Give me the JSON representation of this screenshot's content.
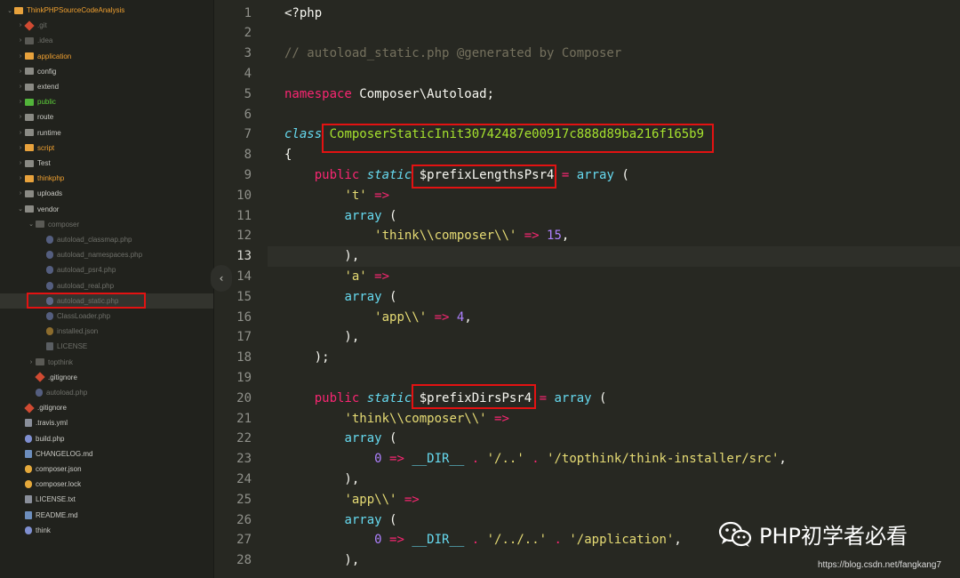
{
  "sidebar": {
    "items": [
      {
        "label": "ThinkPHPSourceCodeAnalysis",
        "kind": "root",
        "color": "orange"
      },
      {
        "label": ".git",
        "kind": "git",
        "color": "dim"
      },
      {
        "label": ".idea",
        "kind": "folder",
        "color": "dim"
      },
      {
        "label": "application",
        "kind": "folder",
        "color": "orange"
      },
      {
        "label": "config",
        "kind": "folder",
        "color": "normal"
      },
      {
        "label": "extend",
        "kind": "folder",
        "color": "normal"
      },
      {
        "label": "public",
        "kind": "folder",
        "color": "green"
      },
      {
        "label": "route",
        "kind": "folder",
        "color": "normal"
      },
      {
        "label": "runtime",
        "kind": "folder",
        "color": "normal"
      },
      {
        "label": "script",
        "kind": "folder",
        "color": "orange"
      },
      {
        "label": "Test",
        "kind": "folder",
        "color": "normal"
      },
      {
        "label": "thinkphp",
        "kind": "folder",
        "color": "orange"
      },
      {
        "label": "uploads",
        "kind": "folder",
        "color": "normal"
      },
      {
        "label": "vendor",
        "kind": "folder-open",
        "color": "normal"
      },
      {
        "label": "composer",
        "kind": "folder-open",
        "color": "dim"
      },
      {
        "label": "autoload_classmap.php",
        "kind": "php",
        "color": "dim"
      },
      {
        "label": "autoload_namespaces.php",
        "kind": "php",
        "color": "dim"
      },
      {
        "label": "autoload_psr4.php",
        "kind": "php",
        "color": "dim"
      },
      {
        "label": "autoload_real.php",
        "kind": "php",
        "color": "dim"
      },
      {
        "label": "autoload_static.php",
        "kind": "php",
        "color": "dim"
      },
      {
        "label": "ClassLoader.php",
        "kind": "php",
        "color": "dim"
      },
      {
        "label": "installed.json",
        "kind": "json",
        "color": "dim"
      },
      {
        "label": "LICENSE",
        "kind": "txt",
        "color": "dim"
      },
      {
        "label": "topthink",
        "kind": "folder",
        "color": "dim"
      },
      {
        "label": ".gitignore",
        "kind": "git",
        "color": "normal"
      },
      {
        "label": "autoload.php",
        "kind": "php",
        "color": "dim"
      },
      {
        "label": ".gitignore",
        "kind": "git",
        "color": "normal"
      },
      {
        "label": ".travis.yml",
        "kind": "txt",
        "color": "normal"
      },
      {
        "label": "build.php",
        "kind": "php",
        "color": "normal"
      },
      {
        "label": "CHANGELOG.md",
        "kind": "md",
        "color": "normal"
      },
      {
        "label": "composer.json",
        "kind": "json",
        "color": "normal"
      },
      {
        "label": "composer.lock",
        "kind": "lock",
        "color": "normal"
      },
      {
        "label": "LICENSE.txt",
        "kind": "txt",
        "color": "normal"
      },
      {
        "label": "README.md",
        "kind": "md",
        "color": "normal"
      },
      {
        "label": "think",
        "kind": "php",
        "color": "normal"
      }
    ],
    "selected_item": "autoload_static.php",
    "collapse_glyph": "‹"
  },
  "editor": {
    "filename": "autoload_static.php",
    "active_line": 13,
    "line_numbers": [
      "1",
      "2",
      "3",
      "4",
      "5",
      "6",
      "7",
      "8",
      "9",
      "10",
      "11",
      "12",
      "13",
      "14",
      "15",
      "16",
      "17",
      "18",
      "19",
      "20",
      "21",
      "22",
      "23",
      "24",
      "25",
      "26",
      "27",
      "28"
    ],
    "lines": [
      {
        "tokens": [
          {
            "t": "<?php",
            "c": "var"
          }
        ]
      },
      {
        "tokens": []
      },
      {
        "tokens": [
          {
            "t": "// autoload_static.php @generated by Composer",
            "c": "cm"
          }
        ]
      },
      {
        "tokens": []
      },
      {
        "tokens": [
          {
            "t": "namespace",
            "c": "kw"
          },
          {
            "t": " Composer\\Autoload;",
            "c": "var"
          }
        ]
      },
      {
        "tokens": []
      },
      {
        "tokens": [
          {
            "t": "class",
            "c": "st"
          },
          {
            "t": " ",
            "c": "var"
          },
          {
            "t": "ComposerStaticInit30742487e00917c888d89ba216f165b9",
            "c": "cls"
          }
        ]
      },
      {
        "tokens": [
          {
            "t": "{",
            "c": "var"
          }
        ]
      },
      {
        "tokens": [
          {
            "t": "    public ",
            "c": "kw"
          },
          {
            "t": "static",
            "c": "st"
          },
          {
            "t": " ",
            "c": "var"
          },
          {
            "t": "$prefixLengthsPsr4",
            "c": "var"
          },
          {
            "t": " = ",
            "c": "kw"
          },
          {
            "t": "array",
            "c": "fn"
          },
          {
            "t": " (",
            "c": "var"
          }
        ]
      },
      {
        "tokens": [
          {
            "t": "        ",
            "c": "var"
          },
          {
            "t": "'t'",
            "c": "str"
          },
          {
            "t": " =>",
            "c": "kw"
          }
        ]
      },
      {
        "tokens": [
          {
            "t": "        ",
            "c": "var"
          },
          {
            "t": "array",
            "c": "fn"
          },
          {
            "t": " (",
            "c": "var"
          }
        ]
      },
      {
        "tokens": [
          {
            "t": "            ",
            "c": "var"
          },
          {
            "t": "'think\\\\composer\\\\'",
            "c": "str"
          },
          {
            "t": " => ",
            "c": "kw"
          },
          {
            "t": "15",
            "c": "num"
          },
          {
            "t": ",",
            "c": "var"
          }
        ]
      },
      {
        "tokens": [
          {
            "t": "        ),",
            "c": "var"
          }
        ]
      },
      {
        "tokens": [
          {
            "t": "        ",
            "c": "var"
          },
          {
            "t": "'a'",
            "c": "str"
          },
          {
            "t": " =>",
            "c": "kw"
          }
        ]
      },
      {
        "tokens": [
          {
            "t": "        ",
            "c": "var"
          },
          {
            "t": "array",
            "c": "fn"
          },
          {
            "t": " (",
            "c": "var"
          }
        ]
      },
      {
        "tokens": [
          {
            "t": "            ",
            "c": "var"
          },
          {
            "t": "'app\\\\'",
            "c": "str"
          },
          {
            "t": " => ",
            "c": "kw"
          },
          {
            "t": "4",
            "c": "num"
          },
          {
            "t": ",",
            "c": "var"
          }
        ]
      },
      {
        "tokens": [
          {
            "t": "        ),",
            "c": "var"
          }
        ]
      },
      {
        "tokens": [
          {
            "t": "    );",
            "c": "var"
          }
        ]
      },
      {
        "tokens": []
      },
      {
        "tokens": [
          {
            "t": "    public ",
            "c": "kw"
          },
          {
            "t": "static",
            "c": "st"
          },
          {
            "t": " ",
            "c": "var"
          },
          {
            "t": "$prefixDirsPsr4",
            "c": "var"
          },
          {
            "t": " = ",
            "c": "kw"
          },
          {
            "t": "array",
            "c": "fn"
          },
          {
            "t": " (",
            "c": "var"
          }
        ]
      },
      {
        "tokens": [
          {
            "t": "        ",
            "c": "var"
          },
          {
            "t": "'think\\\\composer\\\\'",
            "c": "str"
          },
          {
            "t": " =>",
            "c": "kw"
          }
        ]
      },
      {
        "tokens": [
          {
            "t": "        ",
            "c": "var"
          },
          {
            "t": "array",
            "c": "fn"
          },
          {
            "t": " (",
            "c": "var"
          }
        ]
      },
      {
        "tokens": [
          {
            "t": "            ",
            "c": "var"
          },
          {
            "t": "0",
            "c": "num"
          },
          {
            "t": " => ",
            "c": "kw"
          },
          {
            "t": "__DIR__",
            "c": "fn"
          },
          {
            "t": " . ",
            "c": "kw"
          },
          {
            "t": "'/..'",
            "c": "str"
          },
          {
            "t": " . ",
            "c": "kw"
          },
          {
            "t": "'/topthink/think-installer/src'",
            "c": "str"
          },
          {
            "t": ",",
            "c": "var"
          }
        ]
      },
      {
        "tokens": [
          {
            "t": "        ),",
            "c": "var"
          }
        ]
      },
      {
        "tokens": [
          {
            "t": "        ",
            "c": "var"
          },
          {
            "t": "'app\\\\'",
            "c": "str"
          },
          {
            "t": " =>",
            "c": "kw"
          }
        ]
      },
      {
        "tokens": [
          {
            "t": "        ",
            "c": "var"
          },
          {
            "t": "array",
            "c": "fn"
          },
          {
            "t": " (",
            "c": "var"
          }
        ]
      },
      {
        "tokens": [
          {
            "t": "            ",
            "c": "var"
          },
          {
            "t": "0",
            "c": "num"
          },
          {
            "t": " => ",
            "c": "kw"
          },
          {
            "t": "__DIR__",
            "c": "fn"
          },
          {
            "t": " . ",
            "c": "kw"
          },
          {
            "t": "'/../..'",
            "c": "str"
          },
          {
            "t": " . ",
            "c": "kw"
          },
          {
            "t": "'/application'",
            "c": "str"
          },
          {
            "t": ",",
            "c": "var"
          }
        ]
      },
      {
        "tokens": [
          {
            "t": "        ),",
            "c": "var"
          }
        ]
      }
    ]
  },
  "watermark": {
    "title": "PHP初学者必看",
    "url": "https://blog.csdn.net/fangkang7"
  }
}
